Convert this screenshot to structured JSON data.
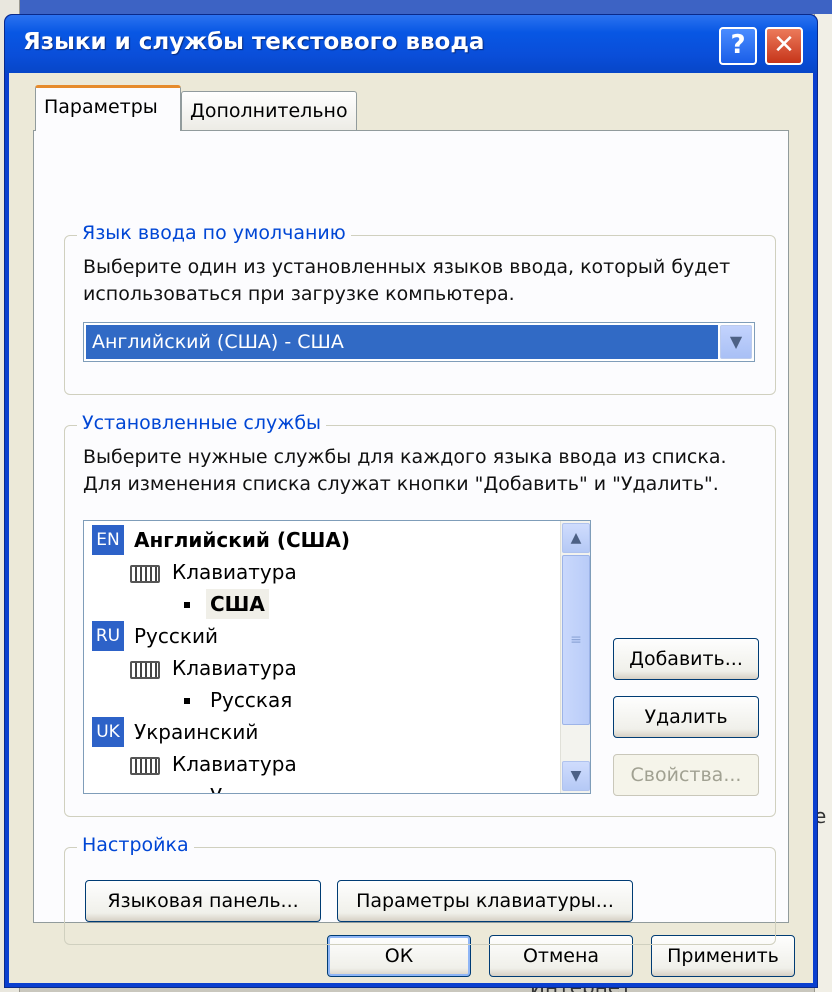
{
  "window": {
    "title": "Языки и службы текстового ввода",
    "help_glyph": "?",
    "close_glyph": "✕"
  },
  "tabs": [
    {
      "label": "Параметры",
      "active": true
    },
    {
      "label": "Дополнительно",
      "active": false
    }
  ],
  "default_language": {
    "group_title": "Язык ввода по умолчанию",
    "description_line1": "Выберите один из установленных языков ввода, который будет",
    "description_line2": "использоваться при загрузке компьютера.",
    "selected_value": "Английский (США) - США"
  },
  "installed_services": {
    "group_title": "Установленные службы",
    "description_line1": "Выберите нужные службы для каждого языка ввода из списка.",
    "description_line2": "Для изменения списка служат кнопки \"Добавить\" и \"Удалить\".",
    "tree": {
      "en_code": "EN",
      "en_name": "Английский (США)",
      "en_kbd": "Клавиатура",
      "en_layout": "США",
      "ru_code": "RU",
      "ru_name": "Русский",
      "ru_kbd": "Клавиатура",
      "ru_layout": "Русская",
      "uk_code": "UK",
      "uk_name": "Украинский",
      "uk_kbd": "Клавиатура",
      "uk_layout": "У"
    },
    "add_button": "Добавить...",
    "remove_button": "Удалить",
    "properties_button": "Свойства..."
  },
  "settings": {
    "group_title": "Настройка",
    "language_bar_button": "Языковая панель...",
    "keyboard_settings_button": "Параметры клавиатуры..."
  },
  "footer": {
    "ok": "ОК",
    "cancel": "Отмена",
    "apply": "Применить"
  },
  "background": {
    "bottom_text": "Интернет",
    "right_text": "е"
  },
  "colors": {
    "titlebar": "#0a4ed9",
    "selection": "#316ac5",
    "group_title": "#0046d5",
    "active_tab_accent": "#e68b2c"
  }
}
